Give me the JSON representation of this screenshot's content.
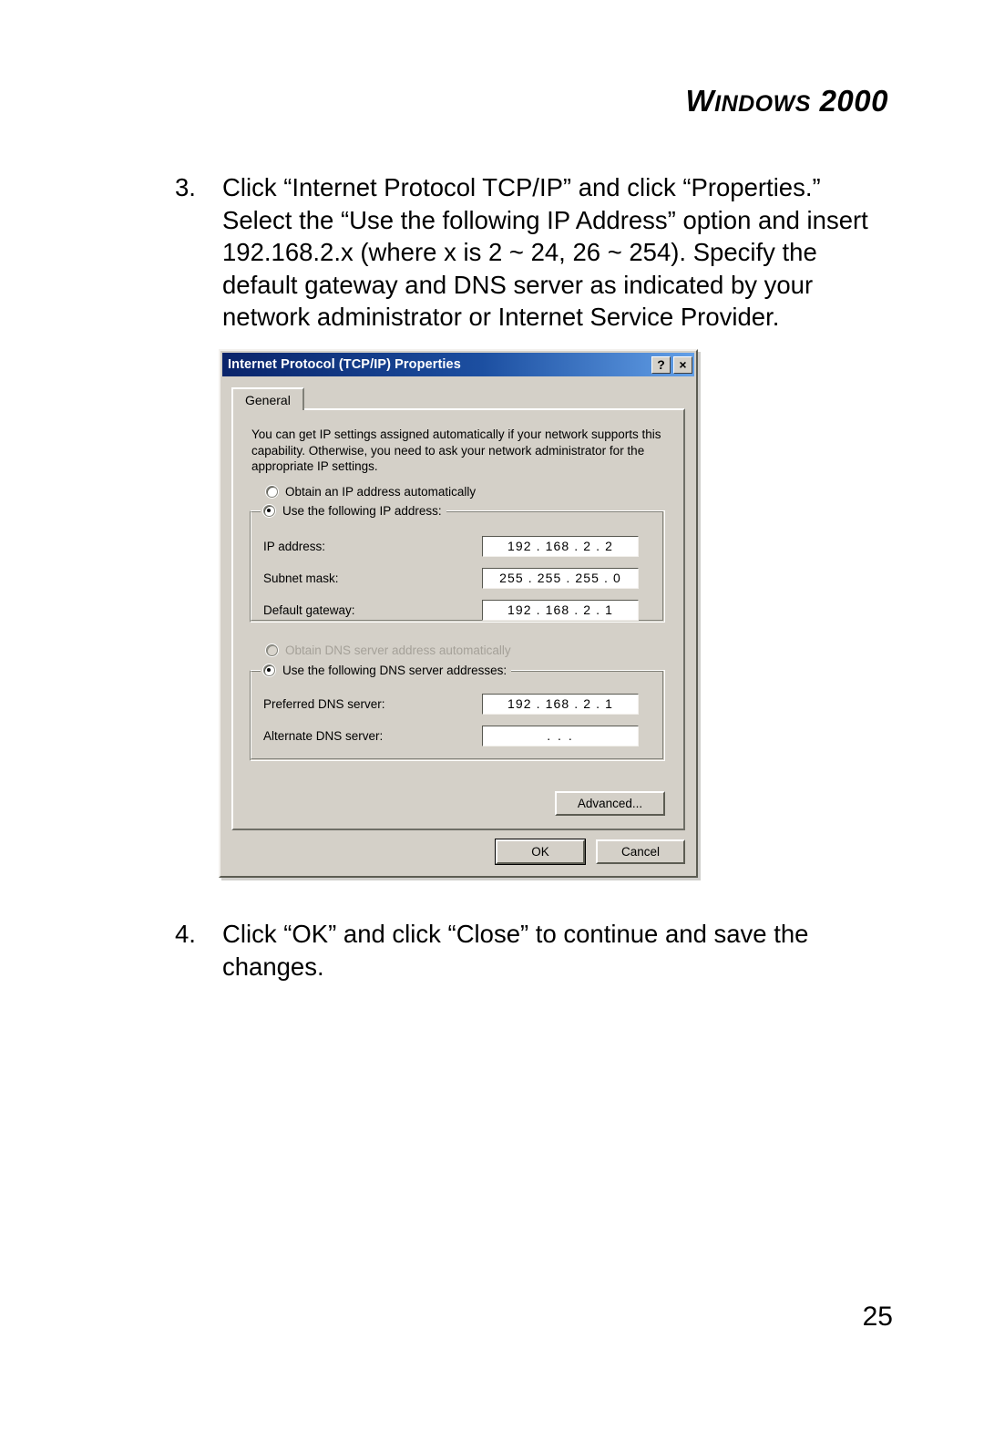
{
  "page": {
    "header_small_caps_lead": "W",
    "header_small_caps_rest": "INDOWS",
    "header_number": "2000",
    "page_number": "25"
  },
  "steps": [
    {
      "number": "3.",
      "text": "Click “Internet Protocol TCP/IP” and click “Properties.” Select the “Use the following IP Address” option and insert 192.168.2.x (where x is 2 ~ 24, 26 ~ 254). Specify the default gateway and DNS server as indicated by your network administrator or Internet Service Provider."
    },
    {
      "number": "4.",
      "text": "Click “OK” and click “Close” to continue and save the changes."
    }
  ],
  "dialog": {
    "title": "Internet Protocol (TCP/IP) Properties",
    "help_button": "?",
    "close_button": "×",
    "tabs": [
      {
        "label": "General",
        "selected": true
      }
    ],
    "description": "You can get IP settings assigned automatically if your network supports this capability. Otherwise, you need to ask your network administrator for the appropriate IP settings.",
    "ip_mode": {
      "obtain_automatic_label": "Obtain an IP address automatically",
      "obtain_automatic_selected": false,
      "manual_label": "Use the following IP address:",
      "manual_selected": true
    },
    "ip_fields": [
      {
        "label": "IP address:",
        "value": "192 . 168 .  2  .  2"
      },
      {
        "label": "Subnet mask:",
        "value": "255 . 255 . 255 .  0"
      },
      {
        "label": "Default gateway:",
        "value": "192 . 168 .  2  .  1"
      }
    ],
    "dns_mode": {
      "obtain_automatic_label": "Obtain DNS server address automatically",
      "obtain_automatic_selected": false,
      "obtain_automatic_disabled": true,
      "manual_label": "Use the following DNS server addresses:",
      "manual_selected": true
    },
    "dns_fields": [
      {
        "label": "Preferred DNS server:",
        "value": "192 . 168 .  2  .  1"
      },
      {
        "label": "Alternate DNS server:",
        "value": " .      .      . "
      }
    ],
    "buttons": {
      "advanced": "Advanced...",
      "ok": "OK",
      "cancel": "Cancel"
    },
    "colors": {
      "face": "#d4d0c8",
      "titlebar_start": "#0a246a",
      "titlebar_end": "#63a0e8",
      "field_bg": "#ffffff",
      "disabled_text": "#a5a199"
    }
  }
}
